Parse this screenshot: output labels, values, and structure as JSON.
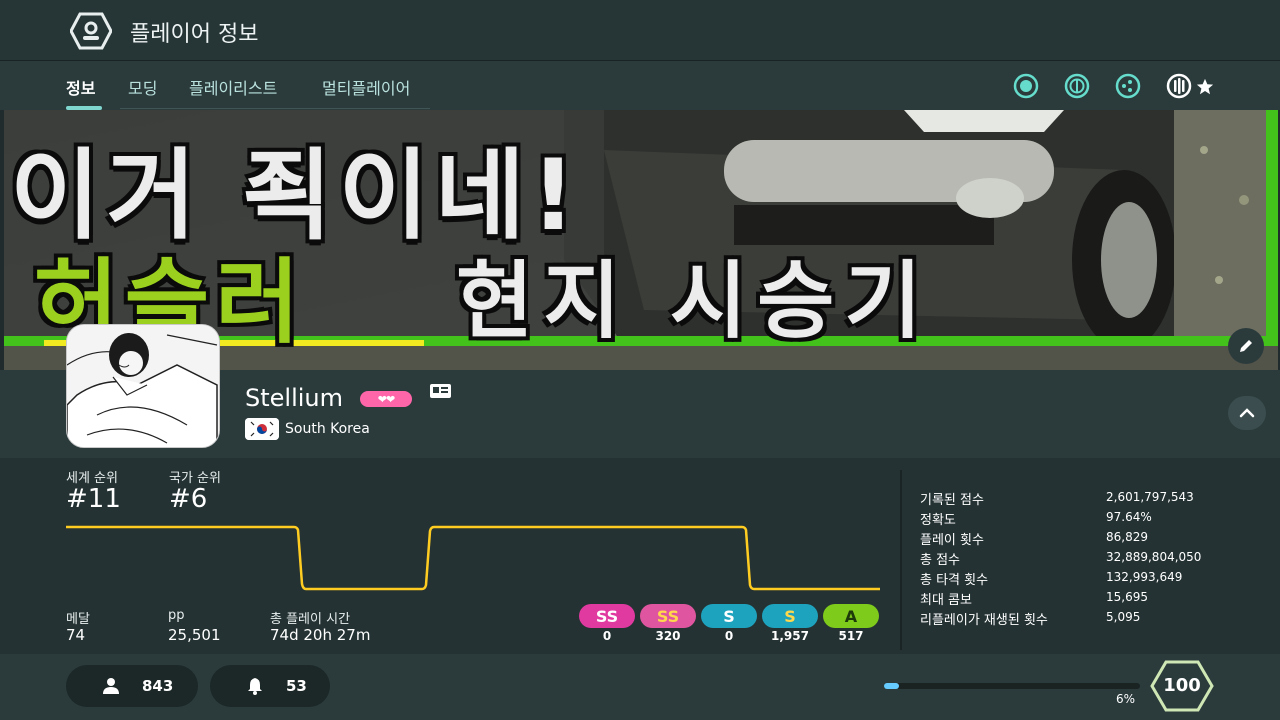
{
  "header": {
    "title": "플레이어 정보"
  },
  "tabs": [
    {
      "label": "정보"
    },
    {
      "label": "모딩"
    },
    {
      "label": "플레이리스트"
    },
    {
      "label": "멀티플레이어"
    }
  ],
  "mode_icons": [
    "osu-icon",
    "taiko-icon",
    "catch-icon",
    "mania-icon"
  ],
  "cover": {
    "line1": "이거 죅이네!",
    "line2_highlight": "허슬러",
    "line2_rest": "현지 시승기"
  },
  "profile": {
    "username": "Stellium",
    "supporter": "❤❤",
    "country": "South Korea"
  },
  "ranks": {
    "global_label": "세계 순위",
    "global_value": "#11",
    "country_label": "국가 순위",
    "country_value": "#6"
  },
  "summary": {
    "medals_label": "메달",
    "medals_value": "74",
    "pp_label": "pp",
    "pp_value": "25,501",
    "playtime_label": "총 플레이 시간",
    "playtime_value": "74d 20h 27m"
  },
  "grades": [
    {
      "label": "SS",
      "count": "0",
      "color": "#e03aa0",
      "text": "#ffffff"
    },
    {
      "label": "SS",
      "count": "320",
      "color": "#e0559f",
      "text": "#ffd84c"
    },
    {
      "label": "S",
      "count": "0",
      "color": "#1ea3bf",
      "text": "#ffffff"
    },
    {
      "label": "S",
      "count": "1,957",
      "color": "#1ea3bf",
      "text": "#ffd84c"
    },
    {
      "label": "A",
      "count": "517",
      "color": "#7ecb1b",
      "text": "#1c3a0a"
    }
  ],
  "stats": [
    {
      "label": "기록된 점수",
      "value": "2,601,797,543"
    },
    {
      "label": "정확도",
      "value": "97.64%"
    },
    {
      "label": "플레이 횟수",
      "value": "86,829"
    },
    {
      "label": "총 점수",
      "value": "32,889,804,050"
    },
    {
      "label": "총 타격 횟수",
      "value": "132,993,649"
    },
    {
      "label": "최대 콤보",
      "value": "15,695"
    },
    {
      "label": "리플레이가 재생된 횟수",
      "value": "5,095"
    }
  ],
  "footer": {
    "followers": "843",
    "mapping_subscribers": "53",
    "level": "100",
    "level_progress_label": "6%",
    "level_progress": 0.06
  },
  "colors": {
    "accent": "#7fd6cf",
    "graph_line": "#ffcc22",
    "supporter_pink": "#ff66aa"
  }
}
